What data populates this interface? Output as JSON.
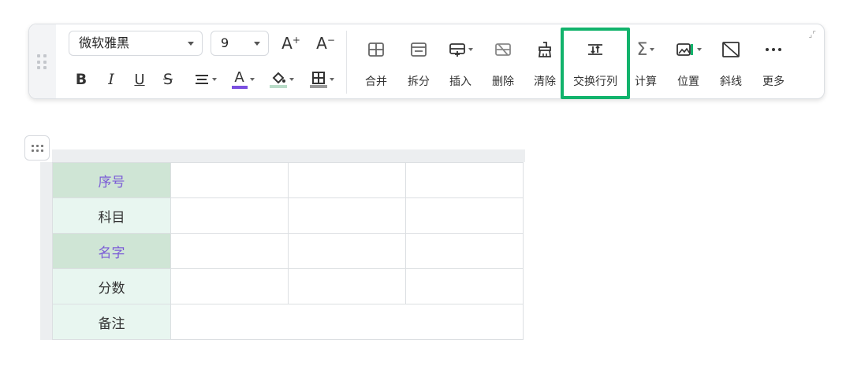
{
  "toolbar": {
    "font_family": "微软雅黑",
    "font_size": "9",
    "increase_font_label": "A",
    "decrease_font_label": "A",
    "bold_label": "B",
    "italic_label": "I",
    "underline_label": "U",
    "strike_label": "S",
    "font_color_label": "A",
    "tools": [
      {
        "label": "合并"
      },
      {
        "label": "拆分"
      },
      {
        "label": "插入"
      },
      {
        "label": "删除"
      },
      {
        "label": "清除"
      },
      {
        "label": "交换行列"
      },
      {
        "label": "计算"
      },
      {
        "label": "位置"
      },
      {
        "label": "斜线"
      },
      {
        "label": "更多"
      }
    ],
    "colors": {
      "font_color": "#7b4fe0",
      "fill_color": "#b9dcc8",
      "highlight": "#12b36c"
    }
  },
  "table": {
    "rows": [
      {
        "header": "序号"
      },
      {
        "header": "科目"
      },
      {
        "header": "名字"
      },
      {
        "header": "分数"
      },
      {
        "header": "备注"
      }
    ],
    "colors": {
      "purple_text": "#7b5cd6",
      "green_cell": "#cfe5d5",
      "mint_cell": "#e8f6f0"
    }
  }
}
